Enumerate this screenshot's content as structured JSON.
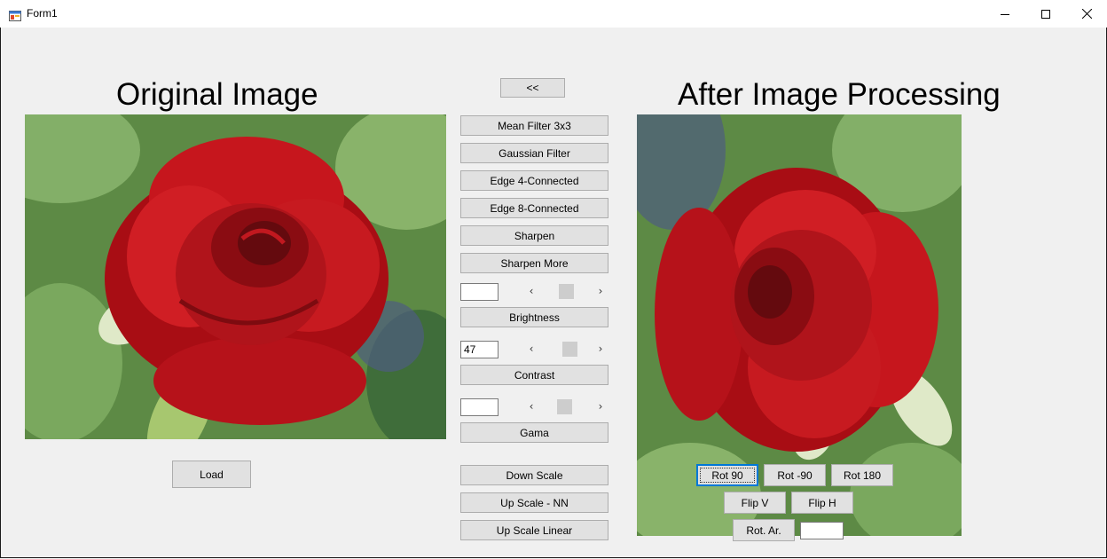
{
  "window": {
    "title": "Form1"
  },
  "headings": {
    "original": "Original Image",
    "processed": "After Image Processing"
  },
  "buttons": {
    "back": "<<",
    "mean_filter": "Mean Filter 3x3",
    "gaussian": "Gaussian Filter",
    "edge4": "Edge 4-Connected",
    "edge8": "Edge 8-Connected",
    "sharpen": "Sharpen",
    "sharpen_more": "Sharpen More",
    "brightness": "Brightness",
    "contrast": "Contrast",
    "gama": "Gama",
    "down_scale": "Down Scale",
    "up_scale_nn": "Up Scale - NN",
    "up_scale_linear": "Up Scale Linear",
    "load": "Load",
    "rot90": "Rot 90",
    "rot_neg90": "Rot -90",
    "rot180": "Rot 180",
    "flip_v": "Flip V",
    "flip_h": "Flip H",
    "rot_ar": "Rot. Ar."
  },
  "fields": {
    "brightness_value": "",
    "contrast_value": "47",
    "gama_value": "",
    "rot_ar_value": ""
  },
  "icons": {
    "app": "form-icon",
    "minimize": "minimize-icon",
    "maximize": "maximize-icon",
    "close": "close-icon",
    "scroll_left": "chevron-left-icon",
    "scroll_right": "chevron-right-icon"
  },
  "sliders": {
    "brightness": 0.5,
    "contrast": 0.6,
    "gama": 0.47
  },
  "colors": {
    "focus_accent": "#0078d7",
    "rose_red": "#c8141a",
    "leaf_green": "#4a7a3a"
  }
}
